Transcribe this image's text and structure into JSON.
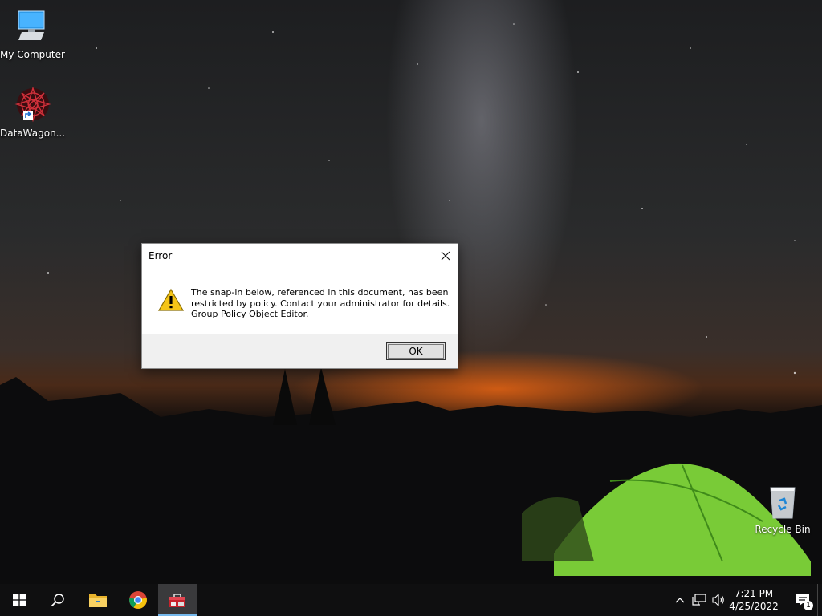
{
  "desktop": {
    "icons": [
      {
        "label": "My Computer"
      },
      {
        "label": "DataWagon..."
      },
      {
        "label": "Recycle Bin"
      }
    ]
  },
  "dialog": {
    "title": "Error",
    "message_lines": [
      "The snap-in below, referenced in this document, has been",
      "restricted by policy. Contact your administrator for details.",
      "Group Policy Object Editor."
    ],
    "ok_label": "OK",
    "icon": "warning-icon"
  },
  "taskbar": {
    "items": [
      {
        "name": "start-icon"
      },
      {
        "name": "search-icon"
      },
      {
        "name": "file-explorer-icon"
      },
      {
        "name": "chrome-icon"
      },
      {
        "name": "toolbox-app-icon",
        "active": true
      }
    ],
    "clock": {
      "time": "7:21 PM",
      "date": "4/25/2022"
    },
    "notification_count": "1"
  }
}
